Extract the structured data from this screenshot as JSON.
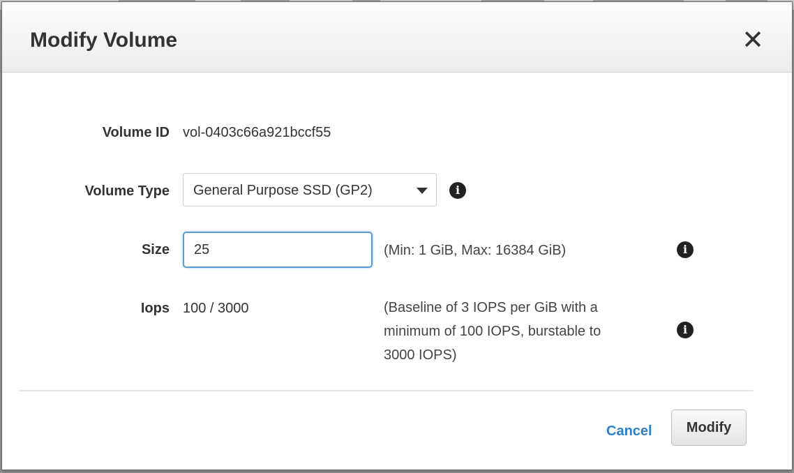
{
  "dialog": {
    "title": "Modify Volume",
    "close_symbol": "✕"
  },
  "form": {
    "volume_id_label": "Volume ID",
    "volume_id_value": "vol-0403c66a921bccf55",
    "volume_type_label": "Volume Type",
    "volume_type_selected": "General Purpose SSD (GP2)",
    "size_label": "Size",
    "size_value": "25",
    "size_help": "(Min: 1 GiB, Max: 16384 GiB)",
    "iops_label": "Iops",
    "iops_value": "100 / 3000",
    "iops_help_lines": [
      "(Baseline of 3 IOPS per GiB with a",
      "minimum of 100 IOPS, burstable to",
      "3000 IOPS)"
    ]
  },
  "footer": {
    "cancel_label": "Cancel",
    "modify_label": "Modify"
  },
  "icons": {
    "info": "info-icon",
    "close": "close-icon",
    "dropdown": "chevron-down-icon"
  },
  "colors": {
    "link": "#2d7fc9",
    "focus_border": "#5b9bd5"
  }
}
